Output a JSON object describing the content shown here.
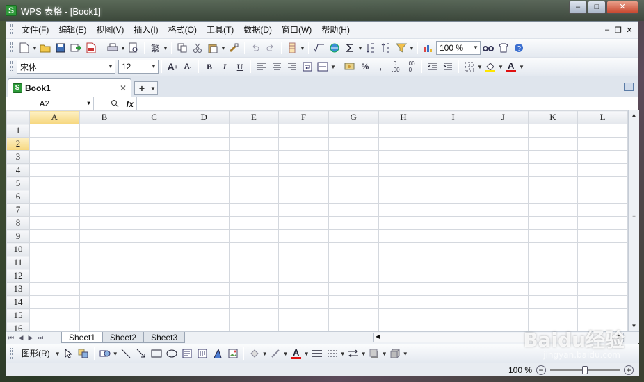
{
  "window": {
    "title": "WPS 表格 - [Book1]",
    "logo_letter": "S",
    "minimize": "‒",
    "maximize": "□",
    "close": "✕"
  },
  "menu": {
    "items": [
      "文件(F)",
      "编辑(E)",
      "视图(V)",
      "插入(I)",
      "格式(O)",
      "工具(T)",
      "数据(D)",
      "窗口(W)",
      "帮助(H)"
    ],
    "doc_minimize": "‒",
    "doc_restore": "❐",
    "doc_close": "✕"
  },
  "toolbar": {
    "zoom_value": "100 %",
    "traditional_label": "繁"
  },
  "format": {
    "font_name": "宋体",
    "font_size": "12",
    "bold": "B",
    "italic": "I",
    "underline": "U"
  },
  "tabs": {
    "doc_label": "Book1",
    "close": "✕",
    "new_tab": "+"
  },
  "formula": {
    "name_box": "A2",
    "fx": "fx"
  },
  "grid": {
    "columns": [
      "A",
      "B",
      "C",
      "D",
      "E",
      "F",
      "G",
      "H",
      "I",
      "J",
      "K",
      "L"
    ],
    "rows": [
      "1",
      "2",
      "3",
      "4",
      "5",
      "6",
      "7",
      "8",
      "9",
      "10",
      "11",
      "12",
      "13",
      "14",
      "15",
      "16"
    ],
    "active_col": "A",
    "active_row": "2"
  },
  "sheets": [
    "Sheet1",
    "Sheet2",
    "Sheet3"
  ],
  "drawbar": {
    "shape_menu": "图形(R)"
  },
  "status": {
    "zoom": "100 %",
    "zoom_fraction": 0.5
  },
  "watermark": {
    "brand": "Baidu经验",
    "url": "jingyan.baidu.com"
  },
  "colors": {
    "accent": "#f6d77e",
    "title_bg": "#3c483c",
    "close_btn": "#c6442b"
  }
}
